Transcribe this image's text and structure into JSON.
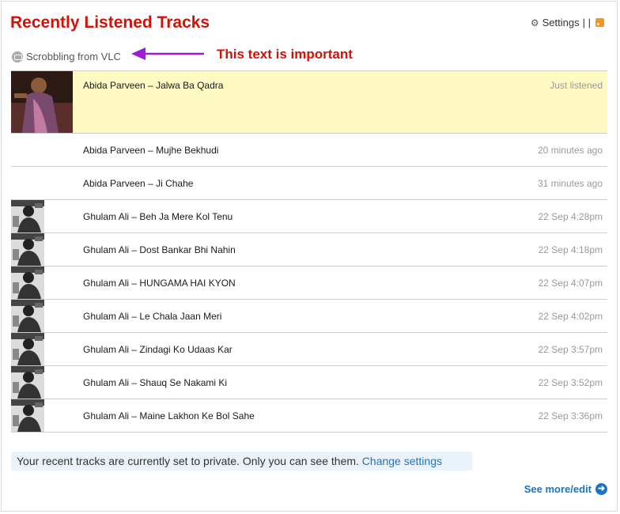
{
  "header": {
    "title": "Recently Listened Tracks",
    "settings_label": "Settings",
    "separator": "| |"
  },
  "scrobbling": {
    "label": "Scrobbling from VLC"
  },
  "annotation": {
    "text": "This text is important"
  },
  "tracks": [
    {
      "name": "Abida Parveen – Jalwa Ba Qadra",
      "time": "Just listened",
      "art": "photo-colour"
    },
    {
      "name": "Abida Parveen – Mujhe Bekhudi",
      "time": "20 minutes ago",
      "art": "none"
    },
    {
      "name": "Abida Parveen – Ji Chahe",
      "time": "31 minutes ago",
      "art": "none"
    },
    {
      "name": "Ghulam Ali – Beh Ja Mere Kol Tenu",
      "time": "22 Sep 4:28pm",
      "art": "photo-bw"
    },
    {
      "name": "Ghulam Ali – Dost Bankar Bhi Nahin",
      "time": "22 Sep 4:18pm",
      "art": "photo-bw"
    },
    {
      "name": "Ghulam Ali – HUNGAMA HAI KYON",
      "time": "22 Sep 4:07pm",
      "art": "photo-bw"
    },
    {
      "name": "Ghulam Ali – Le Chala Jaan Meri",
      "time": "22 Sep 4:02pm",
      "art": "photo-bw"
    },
    {
      "name": "Ghulam Ali – Zindagi Ko Udaas Kar",
      "time": "22 Sep 3:57pm",
      "art": "photo-bw"
    },
    {
      "name": "Ghulam Ali – Shauq Se Nakami Ki",
      "time": "22 Sep 3:52pm",
      "art": "photo-bw"
    },
    {
      "name": "Ghulam Ali – Maine Lakhon Ke Bol Sahe",
      "time": "22 Sep 3:36pm",
      "art": "photo-bw"
    }
  ],
  "privacy": {
    "message": "Your recent tracks are currently set to private. Only you can see them.",
    "link": "Change settings"
  },
  "footer": {
    "see_more": "See more/edit"
  },
  "colors": {
    "title": "#d51007",
    "link": "#1e73be",
    "now_playing_bg": "#fff9c4",
    "annotation_arrow": "#9b1dd8"
  },
  "icons": [
    "gear-icon",
    "rss-icon",
    "vlc-icon",
    "arrow-right-icon"
  ]
}
